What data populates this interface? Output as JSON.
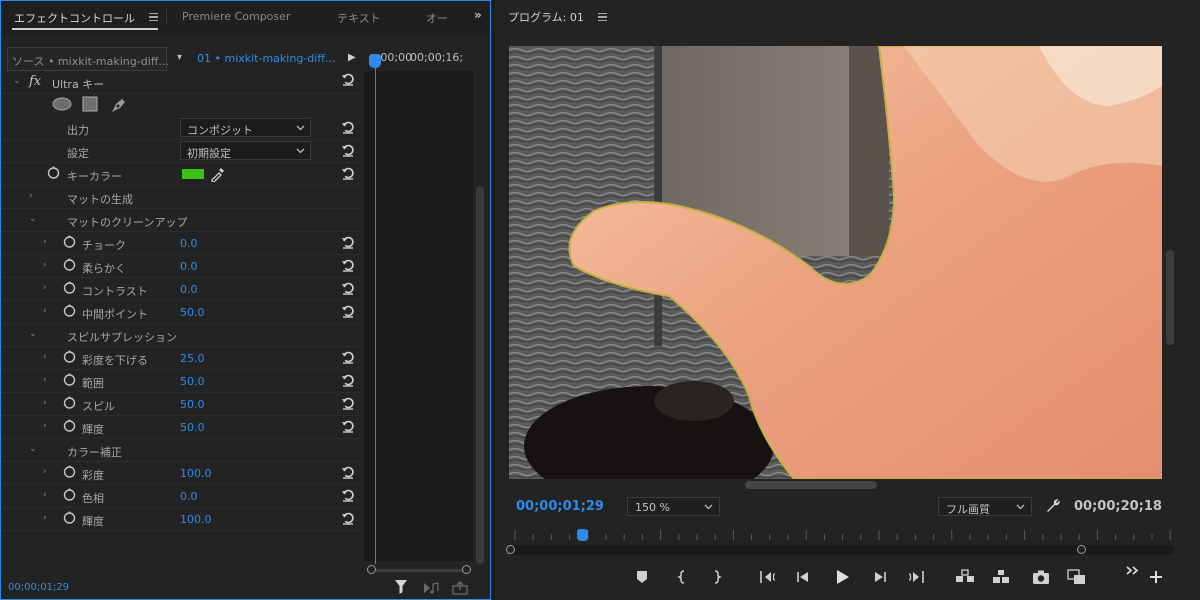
{
  "effect_controls": {
    "tabs": [
      {
        "label": "エフェクトコントロール",
        "active": true
      },
      {
        "label": "Premiere Composer",
        "active": false
      },
      {
        "label": "テキスト",
        "active": false
      },
      {
        "label": "オー",
        "active": false
      }
    ],
    "more_label": "»",
    "source_label": "ソース • mixkit-making-diff...",
    "sequence_clip_label": "01 • mixkit-making-diff...",
    "timeline_times": [
      "::00;00",
      "00;00;16;"
    ],
    "effect_name": "Ultra キー",
    "fx_label": "fx",
    "output": {
      "label": "出力",
      "value": "コンポジット"
    },
    "setting": {
      "label": "設定",
      "value": "初期設定"
    },
    "key_color": {
      "label": "キーカラー",
      "color": "#3cc214"
    },
    "groups": [
      {
        "label": "マットの生成",
        "expanded": false
      },
      {
        "label": "マットのクリーンアップ",
        "expanded": true,
        "params": [
          {
            "label": "チョーク",
            "value": "0.0"
          },
          {
            "label": "柔らかく",
            "value": "0.0"
          },
          {
            "label": "コントラスト",
            "value": "0.0"
          },
          {
            "label": "中間ポイント",
            "value": "50.0"
          }
        ]
      },
      {
        "label": "スピルサプレッション",
        "expanded": true,
        "params": [
          {
            "label": "彩度を下げる",
            "value": "25.0"
          },
          {
            "label": "範囲",
            "value": "50.0"
          },
          {
            "label": "スピル",
            "value": "50.0"
          },
          {
            "label": "輝度",
            "value": "50.0"
          }
        ]
      },
      {
        "label": "カラー補正",
        "expanded": true,
        "params": [
          {
            "label": "彩度",
            "value": "100.0"
          },
          {
            "label": "色相",
            "value": "0.0"
          },
          {
            "label": "輝度",
            "value": "100.0"
          }
        ]
      }
    ],
    "status_time": "00;00;01;29"
  },
  "program_monitor": {
    "title": "プログラム: 01",
    "current_time": "00;00;01;29",
    "zoom": "150 %",
    "quality": "フル画質",
    "duration": "00;00;20;18",
    "playhead_fraction": 0.097
  },
  "colors": {
    "accent": "#2d8ceb",
    "panel": "#232323",
    "key_green": "#3cc214"
  }
}
